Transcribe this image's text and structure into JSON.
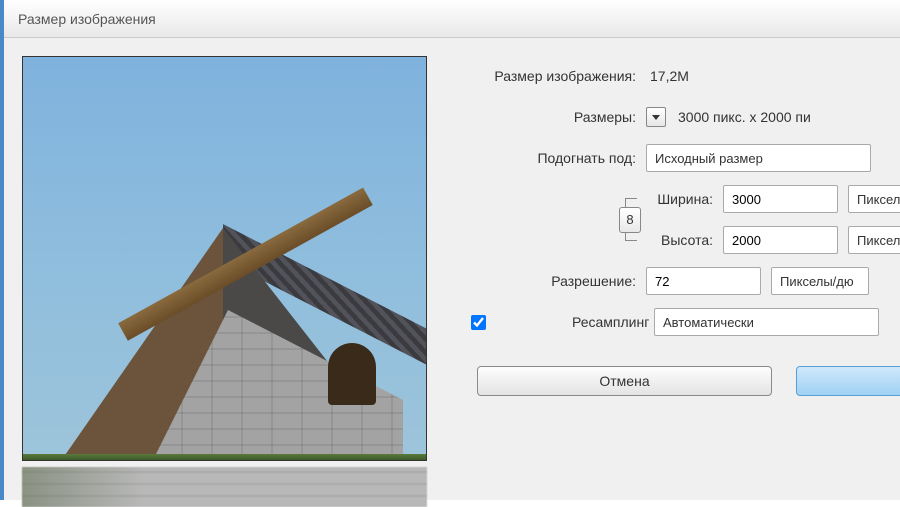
{
  "dialog": {
    "title": "Размер изображения"
  },
  "info": {
    "size_label": "Размер изображения:",
    "size_value": "17,2M",
    "dims_label": "Размеры:",
    "dims_value": "3000 пикс. x 2000 пи"
  },
  "fit": {
    "label": "Подогнать под:",
    "value": "Исходный размер"
  },
  "width": {
    "label": "Ширина:",
    "value": "3000",
    "unit": "Пикселы"
  },
  "height": {
    "label": "Высота:",
    "value": "2000",
    "unit": "Пикселы"
  },
  "link": {
    "glyph": "8"
  },
  "resolution": {
    "label": "Разрешение:",
    "value": "72",
    "unit": "Пикселы/дю"
  },
  "resample": {
    "label": "Ресамплинг",
    "checked": true,
    "value": "Автоматически"
  },
  "buttons": {
    "cancel": "Отмена"
  }
}
